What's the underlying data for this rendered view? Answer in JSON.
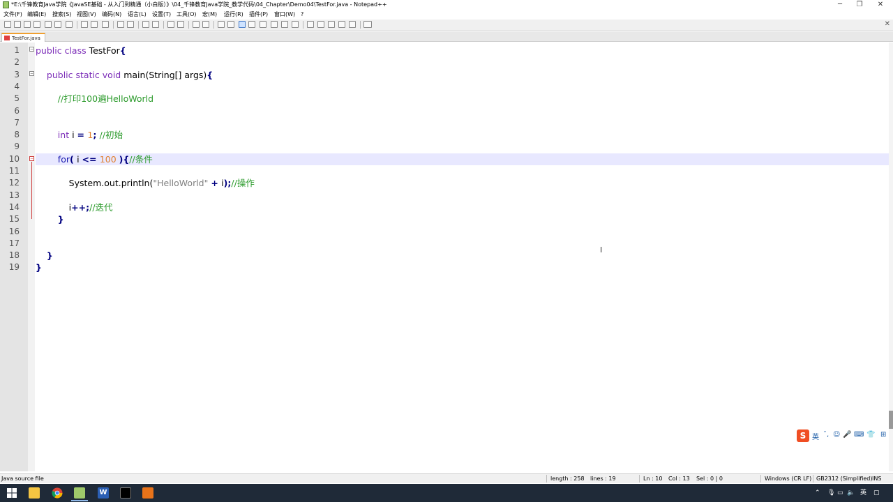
{
  "window": {
    "title": "*E:\\千锋教育Java学院《JavaSE基础 - 从入门到精通（小白版）》\\04_千锋教育Java学院_教学代码\\04_Chapter\\Demo04\\TestFor.java - Notepad++",
    "minimize": "─",
    "maximize": "❐",
    "close": "✕"
  },
  "menu": [
    "文件(F)",
    "编辑(E)",
    "搜索(S)",
    "视图(V)",
    "编码(N)",
    "语言(L)",
    "设置(T)",
    "工具(O)",
    "宏(M)",
    "运行(R)",
    "插件(P)",
    "窗口(W)",
    "?"
  ],
  "toolbar": {
    "close_all": "✕"
  },
  "tab": {
    "label": "TestFor.java"
  },
  "editor": {
    "line_numbers": [
      "1",
      "2",
      "3",
      "4",
      "5",
      "6",
      "7",
      "8",
      "9",
      "10",
      "11",
      "12",
      "13",
      "14",
      "15",
      "16",
      "17",
      "18",
      "19"
    ],
    "lines": [
      {
        "parts": [
          [
            "kw",
            "public class "
          ],
          [
            "txt",
            "TestFor"
          ],
          [
            "op",
            "{"
          ]
        ]
      },
      {
        "parts": []
      },
      {
        "parts": [
          [
            "txt",
            "    "
          ],
          [
            "kw",
            "public static void "
          ],
          [
            "txt",
            "main(String[] args)"
          ],
          [
            "op",
            "{"
          ]
        ]
      },
      {
        "parts": []
      },
      {
        "parts": [
          [
            "txt",
            "        "
          ],
          [
            "cm",
            "//打印100遍HelloWorld"
          ]
        ]
      },
      {
        "parts": []
      },
      {
        "parts": []
      },
      {
        "parts": [
          [
            "txt",
            "        "
          ],
          [
            "kw",
            "int "
          ],
          [
            "txt",
            "i "
          ],
          [
            "op",
            "= "
          ],
          [
            "num",
            "1"
          ],
          [
            "op",
            "; "
          ],
          [
            "cm",
            "//初始"
          ]
        ]
      },
      {
        "parts": []
      },
      {
        "parts": [
          [
            "txt",
            "        "
          ],
          [
            "kw2",
            "for"
          ],
          [
            "op",
            "( "
          ],
          [
            "txt",
            "i "
          ],
          [
            "op",
            "<= "
          ],
          [
            "num",
            "100 "
          ],
          [
            "op",
            ")"
          ],
          [
            "op",
            "{"
          ],
          [
            "cm",
            "//条件"
          ]
        ]
      },
      {
        "parts": []
      },
      {
        "parts": [
          [
            "txt",
            "            System.out.println("
          ],
          [
            "str",
            "\"HelloWorld\""
          ],
          [
            "txt",
            " "
          ],
          [
            "op",
            "+ "
          ],
          [
            "txt",
            "i"
          ],
          [
            "op",
            ");"
          ],
          [
            "cm",
            "//操作"
          ]
        ]
      },
      {
        "parts": []
      },
      {
        "parts": [
          [
            "txt",
            "            i"
          ],
          [
            "op",
            "++;"
          ],
          [
            "cm",
            "//迭代"
          ]
        ]
      },
      {
        "parts": [
          [
            "txt",
            "        "
          ],
          [
            "op",
            "}"
          ]
        ]
      },
      {
        "parts": []
      },
      {
        "parts": []
      },
      {
        "parts": [
          [
            "txt",
            "    "
          ],
          [
            "op",
            "}"
          ]
        ]
      },
      {
        "parts": [
          [
            "op",
            "}"
          ]
        ]
      }
    ],
    "current_line": 10
  },
  "ime": {
    "logo": "S",
    "mode": "英",
    "items": [
      "ˇ,",
      "☺",
      "🎤",
      "⌨",
      "👕",
      "⊞"
    ]
  },
  "status": {
    "file_type": "Java source file",
    "length": "length : 258",
    "lines": "lines : 19",
    "ln": "Ln : 10",
    "col": "Col : 13",
    "sel": "Sel : 0 | 0",
    "eol": "Windows (CR LF)",
    "encoding": "GB2312 (Simplified)",
    "mode": "INS"
  },
  "taskbar": {
    "tray_lang": "英"
  },
  "colors": {
    "keyword": "#7b2cb8",
    "comment": "#2a9a2a",
    "number": "#e08030",
    "current_line": "#e8e8ff"
  }
}
